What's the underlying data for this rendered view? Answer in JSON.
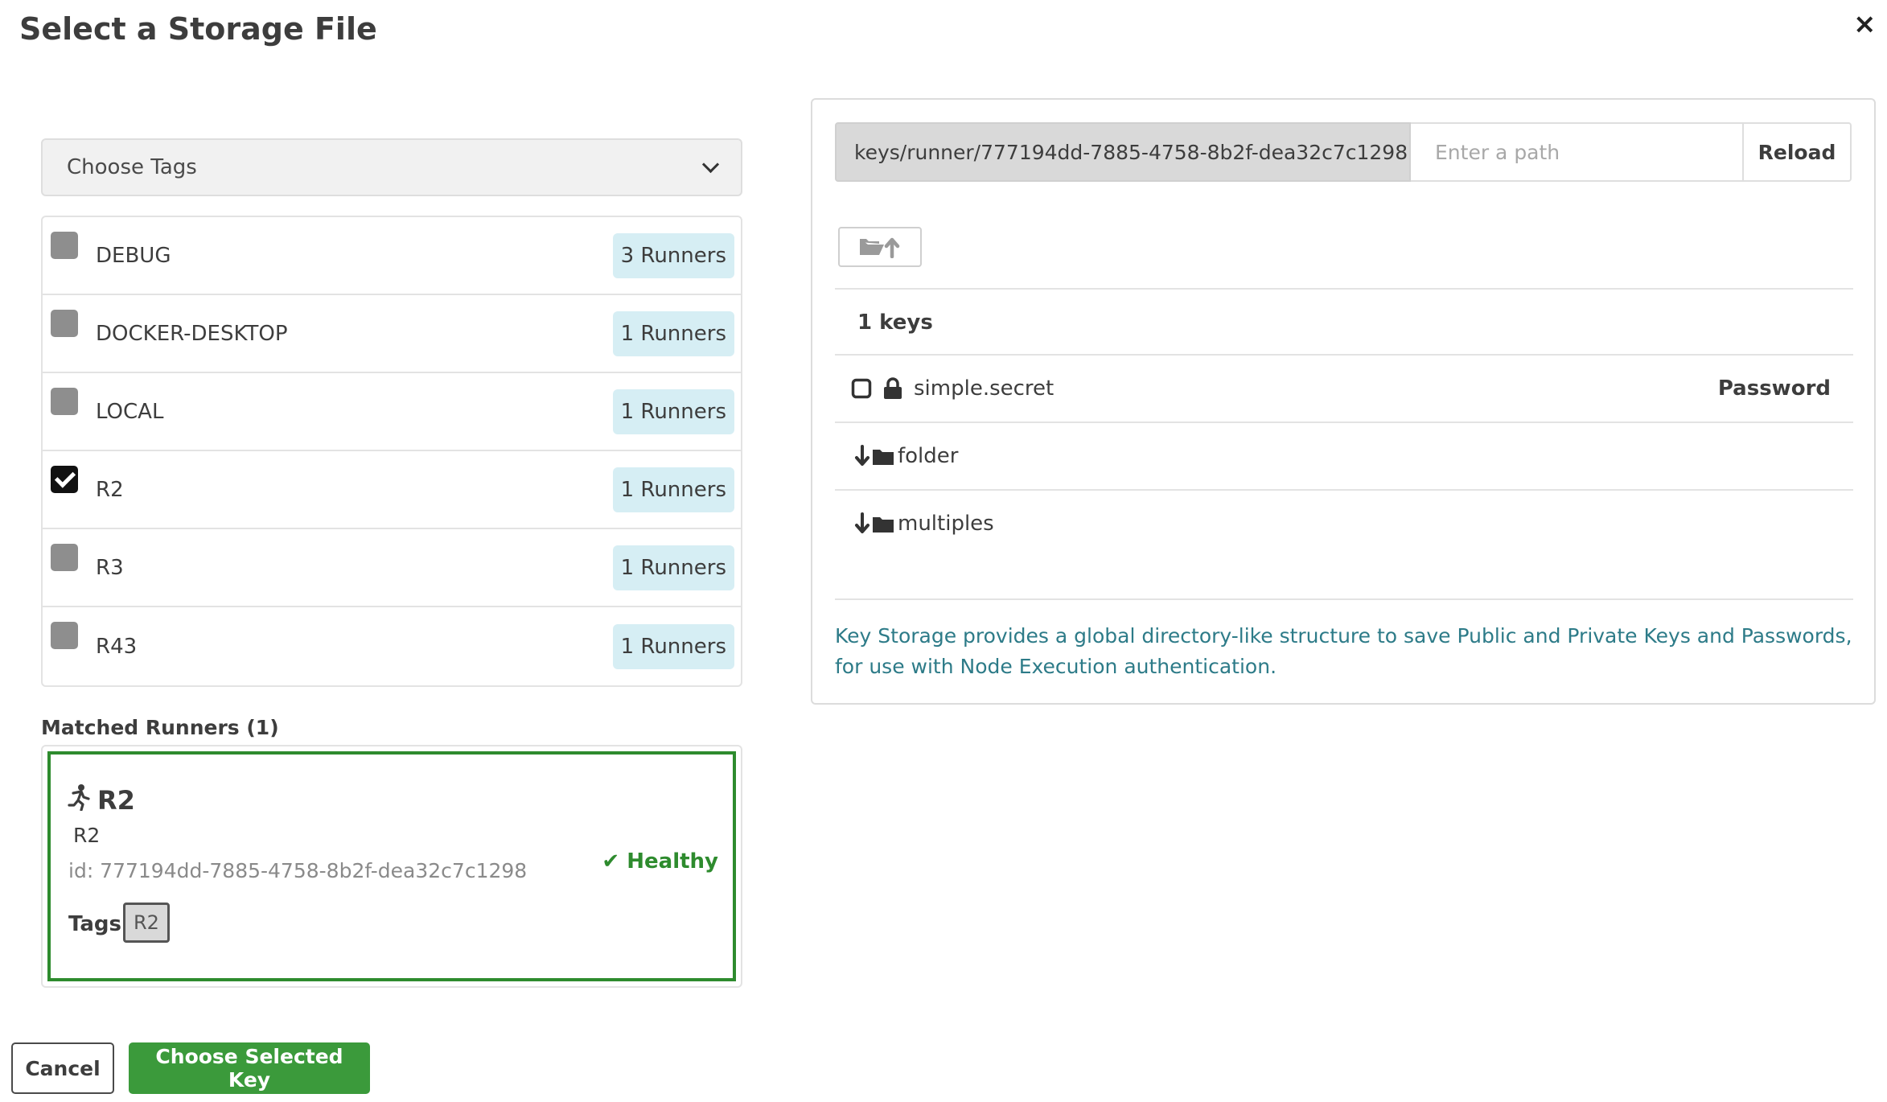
{
  "dialog": {
    "title": "Select a Storage File",
    "close_icon": "×"
  },
  "tag_filter": {
    "selected": "Choose Tags"
  },
  "tags": [
    {
      "name": "DEBUG",
      "runners": "3 Runners",
      "checked": false
    },
    {
      "name": "DOCKER-DESKTOP",
      "runners": "1 Runners",
      "checked": false
    },
    {
      "name": "LOCAL",
      "runners": "1 Runners",
      "checked": false
    },
    {
      "name": "R2",
      "runners": "1 Runners",
      "checked": true
    },
    {
      "name": "R3",
      "runners": "1 Runners",
      "checked": false
    },
    {
      "name": "R43",
      "runners": "1 Runners",
      "checked": false
    }
  ],
  "matched": {
    "label": "Matched Runners (1)",
    "runner": {
      "name": "R2",
      "description": "R2",
      "id": "id: 777194dd-7885-4758-8b2f-dea32c7c1298",
      "status": "Healthy",
      "tags_label": "Tags",
      "tag": "R2"
    }
  },
  "storage": {
    "current_path": "keys/runner/777194dd-7885-4758-8b2f-dea32c7c1298",
    "path_placeholder": "Enter a path",
    "reload_label": "Reload",
    "keys_count": "1  keys",
    "entries": [
      {
        "label": "simple.secret",
        "type": "Password"
      },
      {
        "label": "folder"
      },
      {
        "label": "multiples"
      }
    ],
    "info": "Key Storage provides a global directory-like structure to save Public and Private Keys and Passwords, for use with Node Execution authentication."
  },
  "footer": {
    "cancel_label": "Cancel",
    "choose_label": "Choose Selected Key"
  },
  "colors": {
    "success": "#3b9a3b",
    "badge_bg": "#d6eef4",
    "info_text": "#2d7b88"
  }
}
